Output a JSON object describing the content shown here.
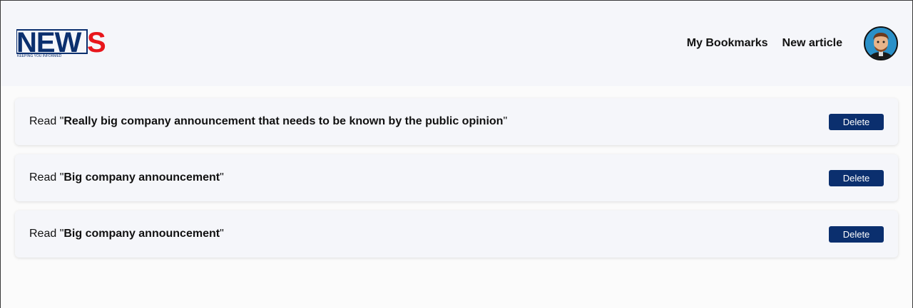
{
  "brand": {
    "logo_main": "NEW",
    "logo_accent": "S",
    "tagline": "KEEPING YOU INFORMED",
    "colors": {
      "primary": "#0b2f6e",
      "accent": "#e8161c"
    }
  },
  "nav": {
    "bookmarks": "My Bookmarks",
    "new_article": "New article"
  },
  "avatar": {
    "icon": "user-avatar"
  },
  "bookmarks": [
    {
      "prefix": "Read \"",
      "title": "Really big company announcement that needs to be known by the public opinion",
      "suffix": "\"",
      "delete_label": "Delete"
    },
    {
      "prefix": "Read \"",
      "title": "Big company announcement",
      "suffix": "\"",
      "delete_label": "Delete"
    },
    {
      "prefix": "Read \"",
      "title": "Big company announcement",
      "suffix": "\"",
      "delete_label": "Delete"
    }
  ]
}
